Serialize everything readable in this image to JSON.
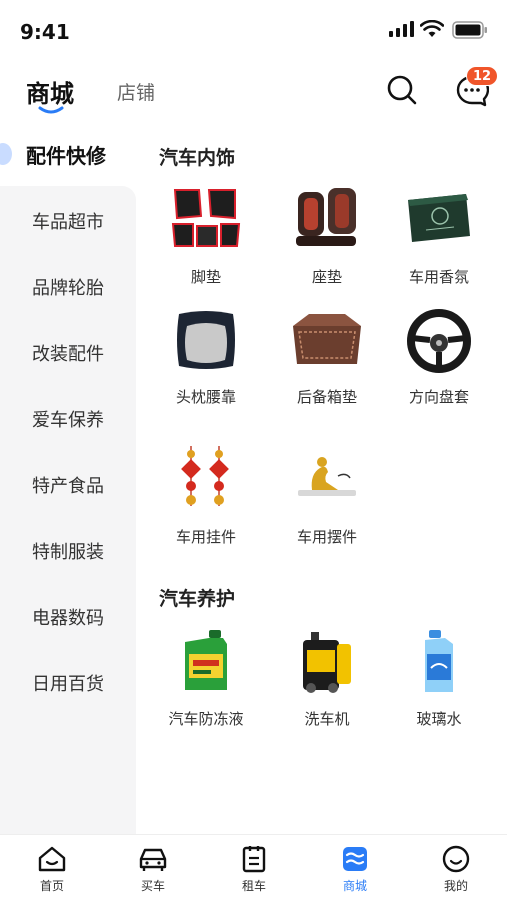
{
  "status": {
    "time": "9:41"
  },
  "topnav": {
    "tabs": [
      {
        "label": "商城"
      },
      {
        "label": "店铺"
      }
    ],
    "message_badge": "12"
  },
  "sidebar": {
    "items": [
      {
        "label": "配件快修",
        "active": true
      },
      {
        "label": "车品超市"
      },
      {
        "label": "品牌轮胎"
      },
      {
        "label": "改装配件"
      },
      {
        "label": "爱车保养"
      },
      {
        "label": "特产食品"
      },
      {
        "label": "特制服装"
      },
      {
        "label": "电器数码"
      },
      {
        "label": "日用百货"
      }
    ]
  },
  "sections": [
    {
      "title": "汽车内饰",
      "items": [
        {
          "label": "脚垫",
          "icon": "floor-mat-icon"
        },
        {
          "label": "座垫",
          "icon": "seat-cushion-icon"
        },
        {
          "label": "车用香氛",
          "icon": "car-fragrance-icon"
        },
        {
          "label": "头枕腰靠",
          "icon": "headrest-pillow-icon"
        },
        {
          "label": "后备箱垫",
          "icon": "trunk-mat-icon"
        },
        {
          "label": "方向盘套",
          "icon": "steering-wheel-cover-icon"
        },
        {
          "label": "车用挂件",
          "icon": "car-pendant-icon"
        },
        {
          "label": "车用摆件",
          "icon": "car-ornament-icon"
        }
      ]
    },
    {
      "title": "汽车养护",
      "items": [
        {
          "label": "汽车防冻液",
          "icon": "antifreeze-icon"
        },
        {
          "label": "洗车机",
          "icon": "car-washer-icon"
        },
        {
          "label": "玻璃水",
          "icon": "glass-water-icon"
        }
      ]
    }
  ],
  "tabbar": {
    "items": [
      {
        "label": "首页",
        "icon": "home-icon"
      },
      {
        "label": "买车",
        "icon": "car-icon"
      },
      {
        "label": "租车",
        "icon": "rent-clipboard-icon"
      },
      {
        "label": "商城",
        "icon": "mall-icon",
        "active": true
      },
      {
        "label": "我的",
        "icon": "profile-smile-icon"
      }
    ]
  },
  "colors": {
    "accent": "#2a7cf6",
    "badge": "#f0552a",
    "sidebar_bg": "#f5f5f6"
  }
}
